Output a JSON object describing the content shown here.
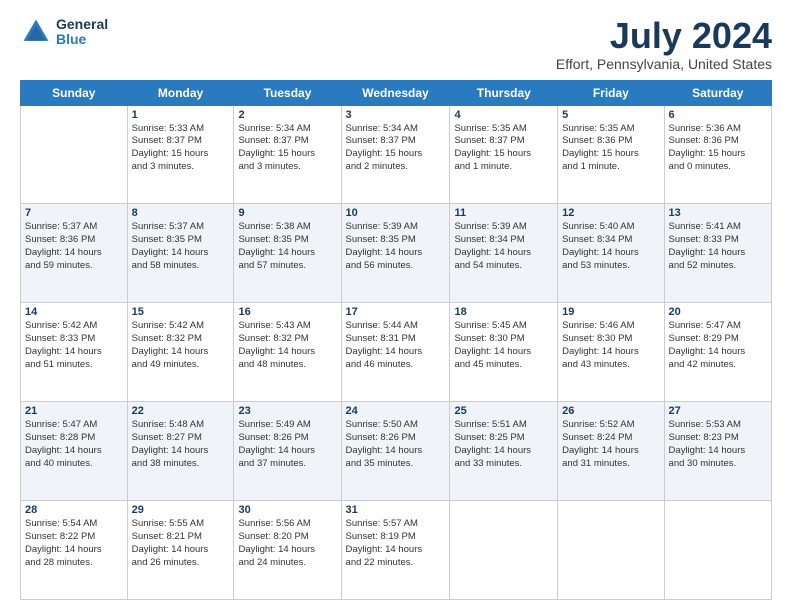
{
  "logo": {
    "general": "General",
    "blue": "Blue"
  },
  "title": "July 2024",
  "subtitle": "Effort, Pennsylvania, United States",
  "days_of_week": [
    "Sunday",
    "Monday",
    "Tuesday",
    "Wednesday",
    "Thursday",
    "Friday",
    "Saturday"
  ],
  "weeks": [
    [
      {
        "day": "",
        "info": ""
      },
      {
        "day": "1",
        "info": "Sunrise: 5:33 AM\nSunset: 8:37 PM\nDaylight: 15 hours\nand 3 minutes."
      },
      {
        "day": "2",
        "info": "Sunrise: 5:34 AM\nSunset: 8:37 PM\nDaylight: 15 hours\nand 3 minutes."
      },
      {
        "day": "3",
        "info": "Sunrise: 5:34 AM\nSunset: 8:37 PM\nDaylight: 15 hours\nand 2 minutes."
      },
      {
        "day": "4",
        "info": "Sunrise: 5:35 AM\nSunset: 8:37 PM\nDaylight: 15 hours\nand 1 minute."
      },
      {
        "day": "5",
        "info": "Sunrise: 5:35 AM\nSunset: 8:36 PM\nDaylight: 15 hours\nand 1 minute."
      },
      {
        "day": "6",
        "info": "Sunrise: 5:36 AM\nSunset: 8:36 PM\nDaylight: 15 hours\nand 0 minutes."
      }
    ],
    [
      {
        "day": "7",
        "info": "Sunrise: 5:37 AM\nSunset: 8:36 PM\nDaylight: 14 hours\nand 59 minutes."
      },
      {
        "day": "8",
        "info": "Sunrise: 5:37 AM\nSunset: 8:35 PM\nDaylight: 14 hours\nand 58 minutes."
      },
      {
        "day": "9",
        "info": "Sunrise: 5:38 AM\nSunset: 8:35 PM\nDaylight: 14 hours\nand 57 minutes."
      },
      {
        "day": "10",
        "info": "Sunrise: 5:39 AM\nSunset: 8:35 PM\nDaylight: 14 hours\nand 56 minutes."
      },
      {
        "day": "11",
        "info": "Sunrise: 5:39 AM\nSunset: 8:34 PM\nDaylight: 14 hours\nand 54 minutes."
      },
      {
        "day": "12",
        "info": "Sunrise: 5:40 AM\nSunset: 8:34 PM\nDaylight: 14 hours\nand 53 minutes."
      },
      {
        "day": "13",
        "info": "Sunrise: 5:41 AM\nSunset: 8:33 PM\nDaylight: 14 hours\nand 52 minutes."
      }
    ],
    [
      {
        "day": "14",
        "info": "Sunrise: 5:42 AM\nSunset: 8:33 PM\nDaylight: 14 hours\nand 51 minutes."
      },
      {
        "day": "15",
        "info": "Sunrise: 5:42 AM\nSunset: 8:32 PM\nDaylight: 14 hours\nand 49 minutes."
      },
      {
        "day": "16",
        "info": "Sunrise: 5:43 AM\nSunset: 8:32 PM\nDaylight: 14 hours\nand 48 minutes."
      },
      {
        "day": "17",
        "info": "Sunrise: 5:44 AM\nSunset: 8:31 PM\nDaylight: 14 hours\nand 46 minutes."
      },
      {
        "day": "18",
        "info": "Sunrise: 5:45 AM\nSunset: 8:30 PM\nDaylight: 14 hours\nand 45 minutes."
      },
      {
        "day": "19",
        "info": "Sunrise: 5:46 AM\nSunset: 8:30 PM\nDaylight: 14 hours\nand 43 minutes."
      },
      {
        "day": "20",
        "info": "Sunrise: 5:47 AM\nSunset: 8:29 PM\nDaylight: 14 hours\nand 42 minutes."
      }
    ],
    [
      {
        "day": "21",
        "info": "Sunrise: 5:47 AM\nSunset: 8:28 PM\nDaylight: 14 hours\nand 40 minutes."
      },
      {
        "day": "22",
        "info": "Sunrise: 5:48 AM\nSunset: 8:27 PM\nDaylight: 14 hours\nand 38 minutes."
      },
      {
        "day": "23",
        "info": "Sunrise: 5:49 AM\nSunset: 8:26 PM\nDaylight: 14 hours\nand 37 minutes."
      },
      {
        "day": "24",
        "info": "Sunrise: 5:50 AM\nSunset: 8:26 PM\nDaylight: 14 hours\nand 35 minutes."
      },
      {
        "day": "25",
        "info": "Sunrise: 5:51 AM\nSunset: 8:25 PM\nDaylight: 14 hours\nand 33 minutes."
      },
      {
        "day": "26",
        "info": "Sunrise: 5:52 AM\nSunset: 8:24 PM\nDaylight: 14 hours\nand 31 minutes."
      },
      {
        "day": "27",
        "info": "Sunrise: 5:53 AM\nSunset: 8:23 PM\nDaylight: 14 hours\nand 30 minutes."
      }
    ],
    [
      {
        "day": "28",
        "info": "Sunrise: 5:54 AM\nSunset: 8:22 PM\nDaylight: 14 hours\nand 28 minutes."
      },
      {
        "day": "29",
        "info": "Sunrise: 5:55 AM\nSunset: 8:21 PM\nDaylight: 14 hours\nand 26 minutes."
      },
      {
        "day": "30",
        "info": "Sunrise: 5:56 AM\nSunset: 8:20 PM\nDaylight: 14 hours\nand 24 minutes."
      },
      {
        "day": "31",
        "info": "Sunrise: 5:57 AM\nSunset: 8:19 PM\nDaylight: 14 hours\nand 22 minutes."
      },
      {
        "day": "",
        "info": ""
      },
      {
        "day": "",
        "info": ""
      },
      {
        "day": "",
        "info": ""
      }
    ]
  ]
}
